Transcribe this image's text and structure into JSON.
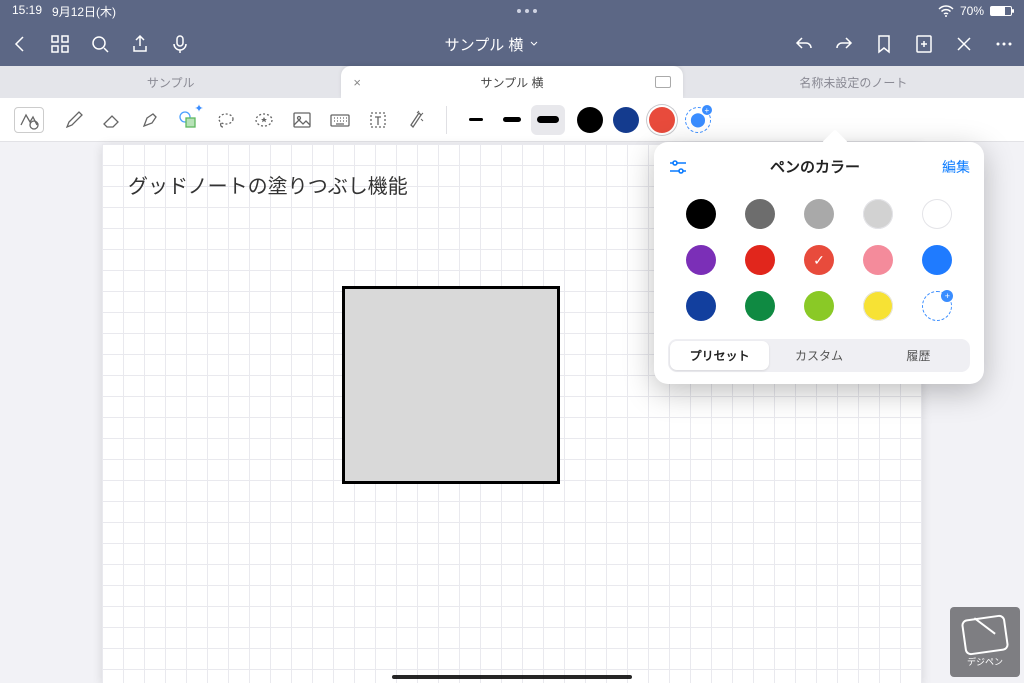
{
  "status": {
    "time": "15:19",
    "date": "9月12日(木)",
    "battery": "70%"
  },
  "nav": {
    "title": "サンプル 横"
  },
  "tabs": [
    {
      "label": "サンプル",
      "active": false
    },
    {
      "label": "サンプル 横",
      "active": true
    },
    {
      "label": "名称未設定のノート",
      "active": false
    }
  ],
  "toolbar": {
    "colors": [
      {
        "hex": "#000000"
      },
      {
        "hex": "#143b8e"
      },
      {
        "hex": "#e84b3c",
        "selected": true
      }
    ]
  },
  "page": {
    "title_text": "グッドノートの塗りつぶし機能"
  },
  "popover": {
    "title": "ペンのカラー",
    "edit": "編集",
    "grid": [
      {
        "hex": "#000000"
      },
      {
        "hex": "#6d6d6d"
      },
      {
        "hex": "#a9a9a9"
      },
      {
        "hex": "#d2d2d2",
        "light": true
      },
      {
        "hex": "#ffffff",
        "light": true
      },
      {
        "hex": "#7b2fb7"
      },
      {
        "hex": "#e1261c"
      },
      {
        "hex": "#e84b3c",
        "selected": true
      },
      {
        "hex": "#f48b9b"
      },
      {
        "hex": "#1f7bff"
      },
      {
        "hex": "#123f9e"
      },
      {
        "hex": "#0f8a42"
      },
      {
        "hex": "#8ac926"
      },
      {
        "hex": "#f7e234",
        "light": true
      }
    ],
    "segments": {
      "preset": "プリセット",
      "custom": "カスタム",
      "history": "履歴"
    }
  },
  "watermark": {
    "label": "デジペン"
  }
}
